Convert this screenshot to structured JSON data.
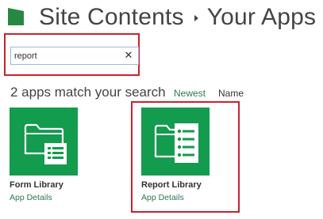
{
  "header": {
    "breadcrumb_parent": "Site Contents",
    "breadcrumb_current": "Your Apps",
    "logo_icon": "sharepoint-logo-icon",
    "separator_icon": "breadcrumb-arrow-icon"
  },
  "search": {
    "value": "report",
    "clear_icon": "close-icon"
  },
  "results": {
    "summary": "2 apps match your search",
    "sort_options": [
      "Newest",
      "Name"
    ]
  },
  "apps": [
    {
      "title": "Form Library",
      "details_link": "App Details",
      "icon": "form-library-icon"
    },
    {
      "title": "Report Library",
      "details_link": "App Details",
      "icon": "report-library-icon"
    }
  ],
  "colors": {
    "tile": "#139b4e",
    "link": "#2b7a4f",
    "highlight": "#c8232c",
    "text": "#444444"
  }
}
